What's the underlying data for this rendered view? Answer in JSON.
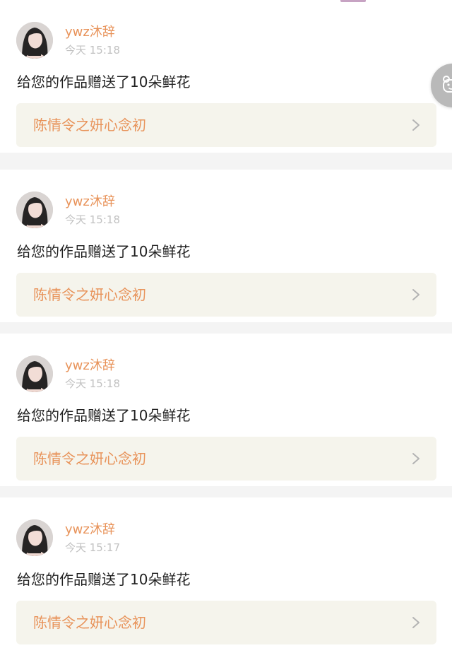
{
  "feed": {
    "items": [
      {
        "username": "ywz沐辞",
        "time": "今天 15:18",
        "message": "给您的作品赠送了10朵鲜花",
        "work_title": "陈情令之妍心念初"
      },
      {
        "username": "ywz沐辞",
        "time": "今天 15:18",
        "message": "给您的作品赠送了10朵鲜花",
        "work_title": "陈情令之妍心念初"
      },
      {
        "username": "ywz沐辞",
        "time": "今天 15:18",
        "message": "给您的作品赠送了10朵鲜花",
        "work_title": "陈情令之妍心念初"
      },
      {
        "username": "ywz沐辞",
        "time": "今天 15:17",
        "message": "给您的作品赠送了10朵鲜花",
        "work_title": "陈情令之妍心念初"
      }
    ]
  },
  "icons": {
    "avatar": "user-avatar",
    "chevron": "chevron-right-icon",
    "float_button": "bear-face-icon"
  },
  "colors": {
    "accent": "#e8935a",
    "timestamp": "#c1c1c1",
    "message": "#222222",
    "link_background": "#f5f4ec",
    "page_background": "#f4f4f4",
    "card_background": "#ffffff",
    "float_button": "#b9b9b9"
  }
}
